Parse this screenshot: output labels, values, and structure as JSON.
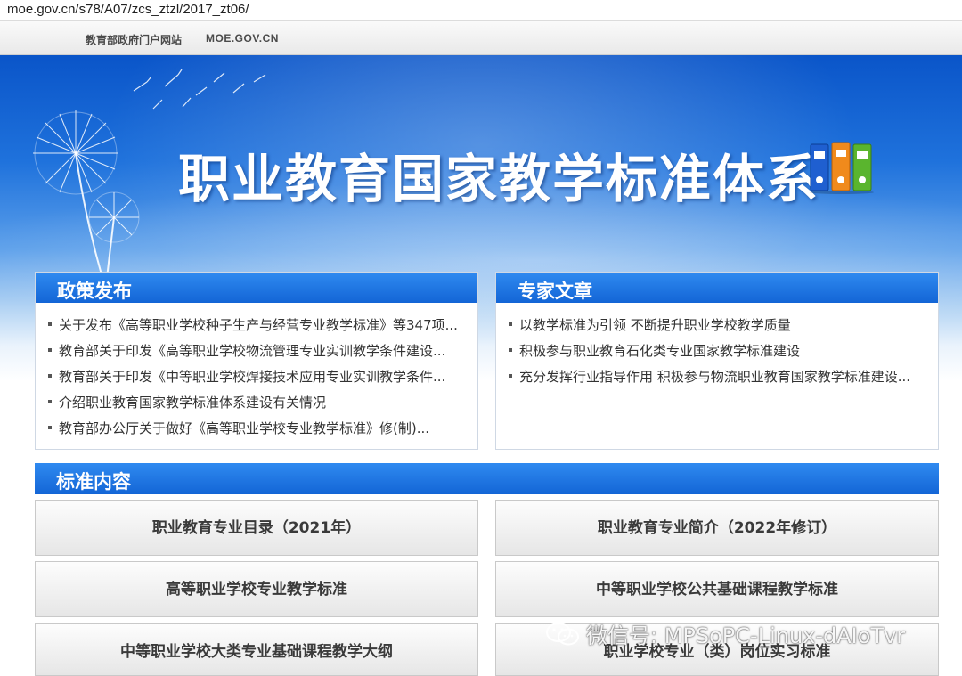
{
  "browser": {
    "url": "moe.gov.cn/s78/A07/zcs_ztzl/2017_zt06/"
  },
  "header": {
    "site_name": "教育部政府门户网站",
    "site_domain": "MOE.GOV.CN"
  },
  "banner": {
    "title": "职业教育国家教学标准体系"
  },
  "policy": {
    "title": "政策发布",
    "items": [
      "关于发布《高等职业学校种子生产与经营专业教学标准》等347项...",
      "教育部关于印发《高等职业学校物流管理专业实训教学条件建设...",
      "教育部关于印发《中等职业学校焊接技术应用专业实训教学条件...",
      "介绍职业教育国家教学标准体系建设有关情况",
      "教育部办公厅关于做好《高等职业学校专业教学标准》修(制)..."
    ]
  },
  "expert": {
    "title": "专家文章",
    "items": [
      "以教学标准为引领 不断提升职业学校教学质量",
      "积极参与职业教育石化类专业国家教学标准建设",
      "充分发挥行业指导作用 积极参与物流职业教育国家教学标准建设..."
    ]
  },
  "standards": {
    "title": "标准内容",
    "buttons": [
      "职业教育专业目录（2021年）",
      "职业教育专业简介（2022年修订）",
      "高等职业学校专业教学标准",
      "中等职业学校公共基础课程教学标准",
      "中等职业学校大类专业基础课程教学大纲",
      "职业学校专业（类）岗位实习标准"
    ]
  },
  "watermark": {
    "text": "微信号: MPSoPC-Linux-dAIoTvr",
    "icon": "wechat-icon"
  },
  "colors": {
    "banner_blue": "#1f72dc",
    "panel_head": "#1a6fe0"
  }
}
